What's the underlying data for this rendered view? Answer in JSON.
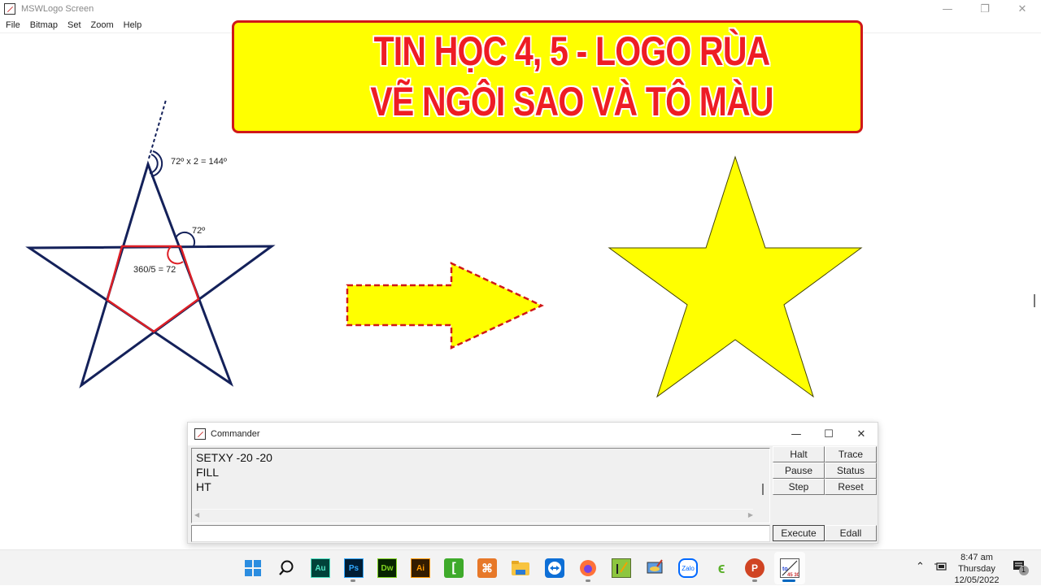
{
  "window": {
    "title": "MSWLogo Screen",
    "controls": {
      "minimize": "—",
      "maximize": "❐",
      "close": "✕"
    }
  },
  "menu": [
    "File",
    "Bitmap",
    "Set",
    "Zoom",
    "Help"
  ],
  "banner": {
    "line1": "TIN HỌC 4, 5 - LOGO RÙA",
    "line2": "VẼ NGÔI SAO VÀ TÔ MÀU",
    "background": "#ffff00",
    "text_color": "#ee1c24",
    "border_color": "#d01818"
  },
  "diagram": {
    "outer_angle_label": "72º x 2 = 144º",
    "exterior_angle_label": "72º",
    "interior_label": "360/5 = 72",
    "star_outline_color": "#14215a",
    "pentagon_color": "#dd1f26"
  },
  "arrow": {
    "fill": "#ffff00",
    "stroke": "#d01818"
  },
  "filled_star": {
    "fill": "#ffff00",
    "stroke": "#555500"
  },
  "commander": {
    "title": "Commander",
    "controls": {
      "minimize": "—",
      "maximize": "☐",
      "close": "✕"
    },
    "output_lines": [
      "SETXY -20 -20",
      "FILL",
      "HT"
    ],
    "input_value": "",
    "buttons": {
      "halt": "Halt",
      "trace": "Trace",
      "pause": "Pause",
      "status": "Status",
      "step": "Step",
      "reset": "Reset",
      "execute": "Execute",
      "edall": "Edall"
    }
  },
  "taskbar": {
    "apps": [
      {
        "name": "start",
        "label": ""
      },
      {
        "name": "search",
        "label": ""
      },
      {
        "name": "audition",
        "label": "Au"
      },
      {
        "name": "photoshop",
        "label": "Ps"
      },
      {
        "name": "dreamweaver",
        "label": "Dw"
      },
      {
        "name": "illustrator",
        "label": "Ai"
      },
      {
        "name": "camtasia",
        "label": ""
      },
      {
        "name": "xampp",
        "label": ""
      },
      {
        "name": "file-explorer",
        "label": ""
      },
      {
        "name": "teamviewer",
        "label": ""
      },
      {
        "name": "firefox",
        "label": ""
      },
      {
        "name": "notepad-plus",
        "label": ""
      },
      {
        "name": "paint-app",
        "label": ""
      },
      {
        "name": "zalo",
        "label": "Zalo"
      },
      {
        "name": "coccoc",
        "label": ""
      },
      {
        "name": "powerpoint",
        "label": "P"
      },
      {
        "name": "mswlogo",
        "label": ""
      }
    ],
    "clock": {
      "time": "8:47 am",
      "day": "Thursday",
      "date": "12/05/2022"
    },
    "notification_count": "1"
  }
}
